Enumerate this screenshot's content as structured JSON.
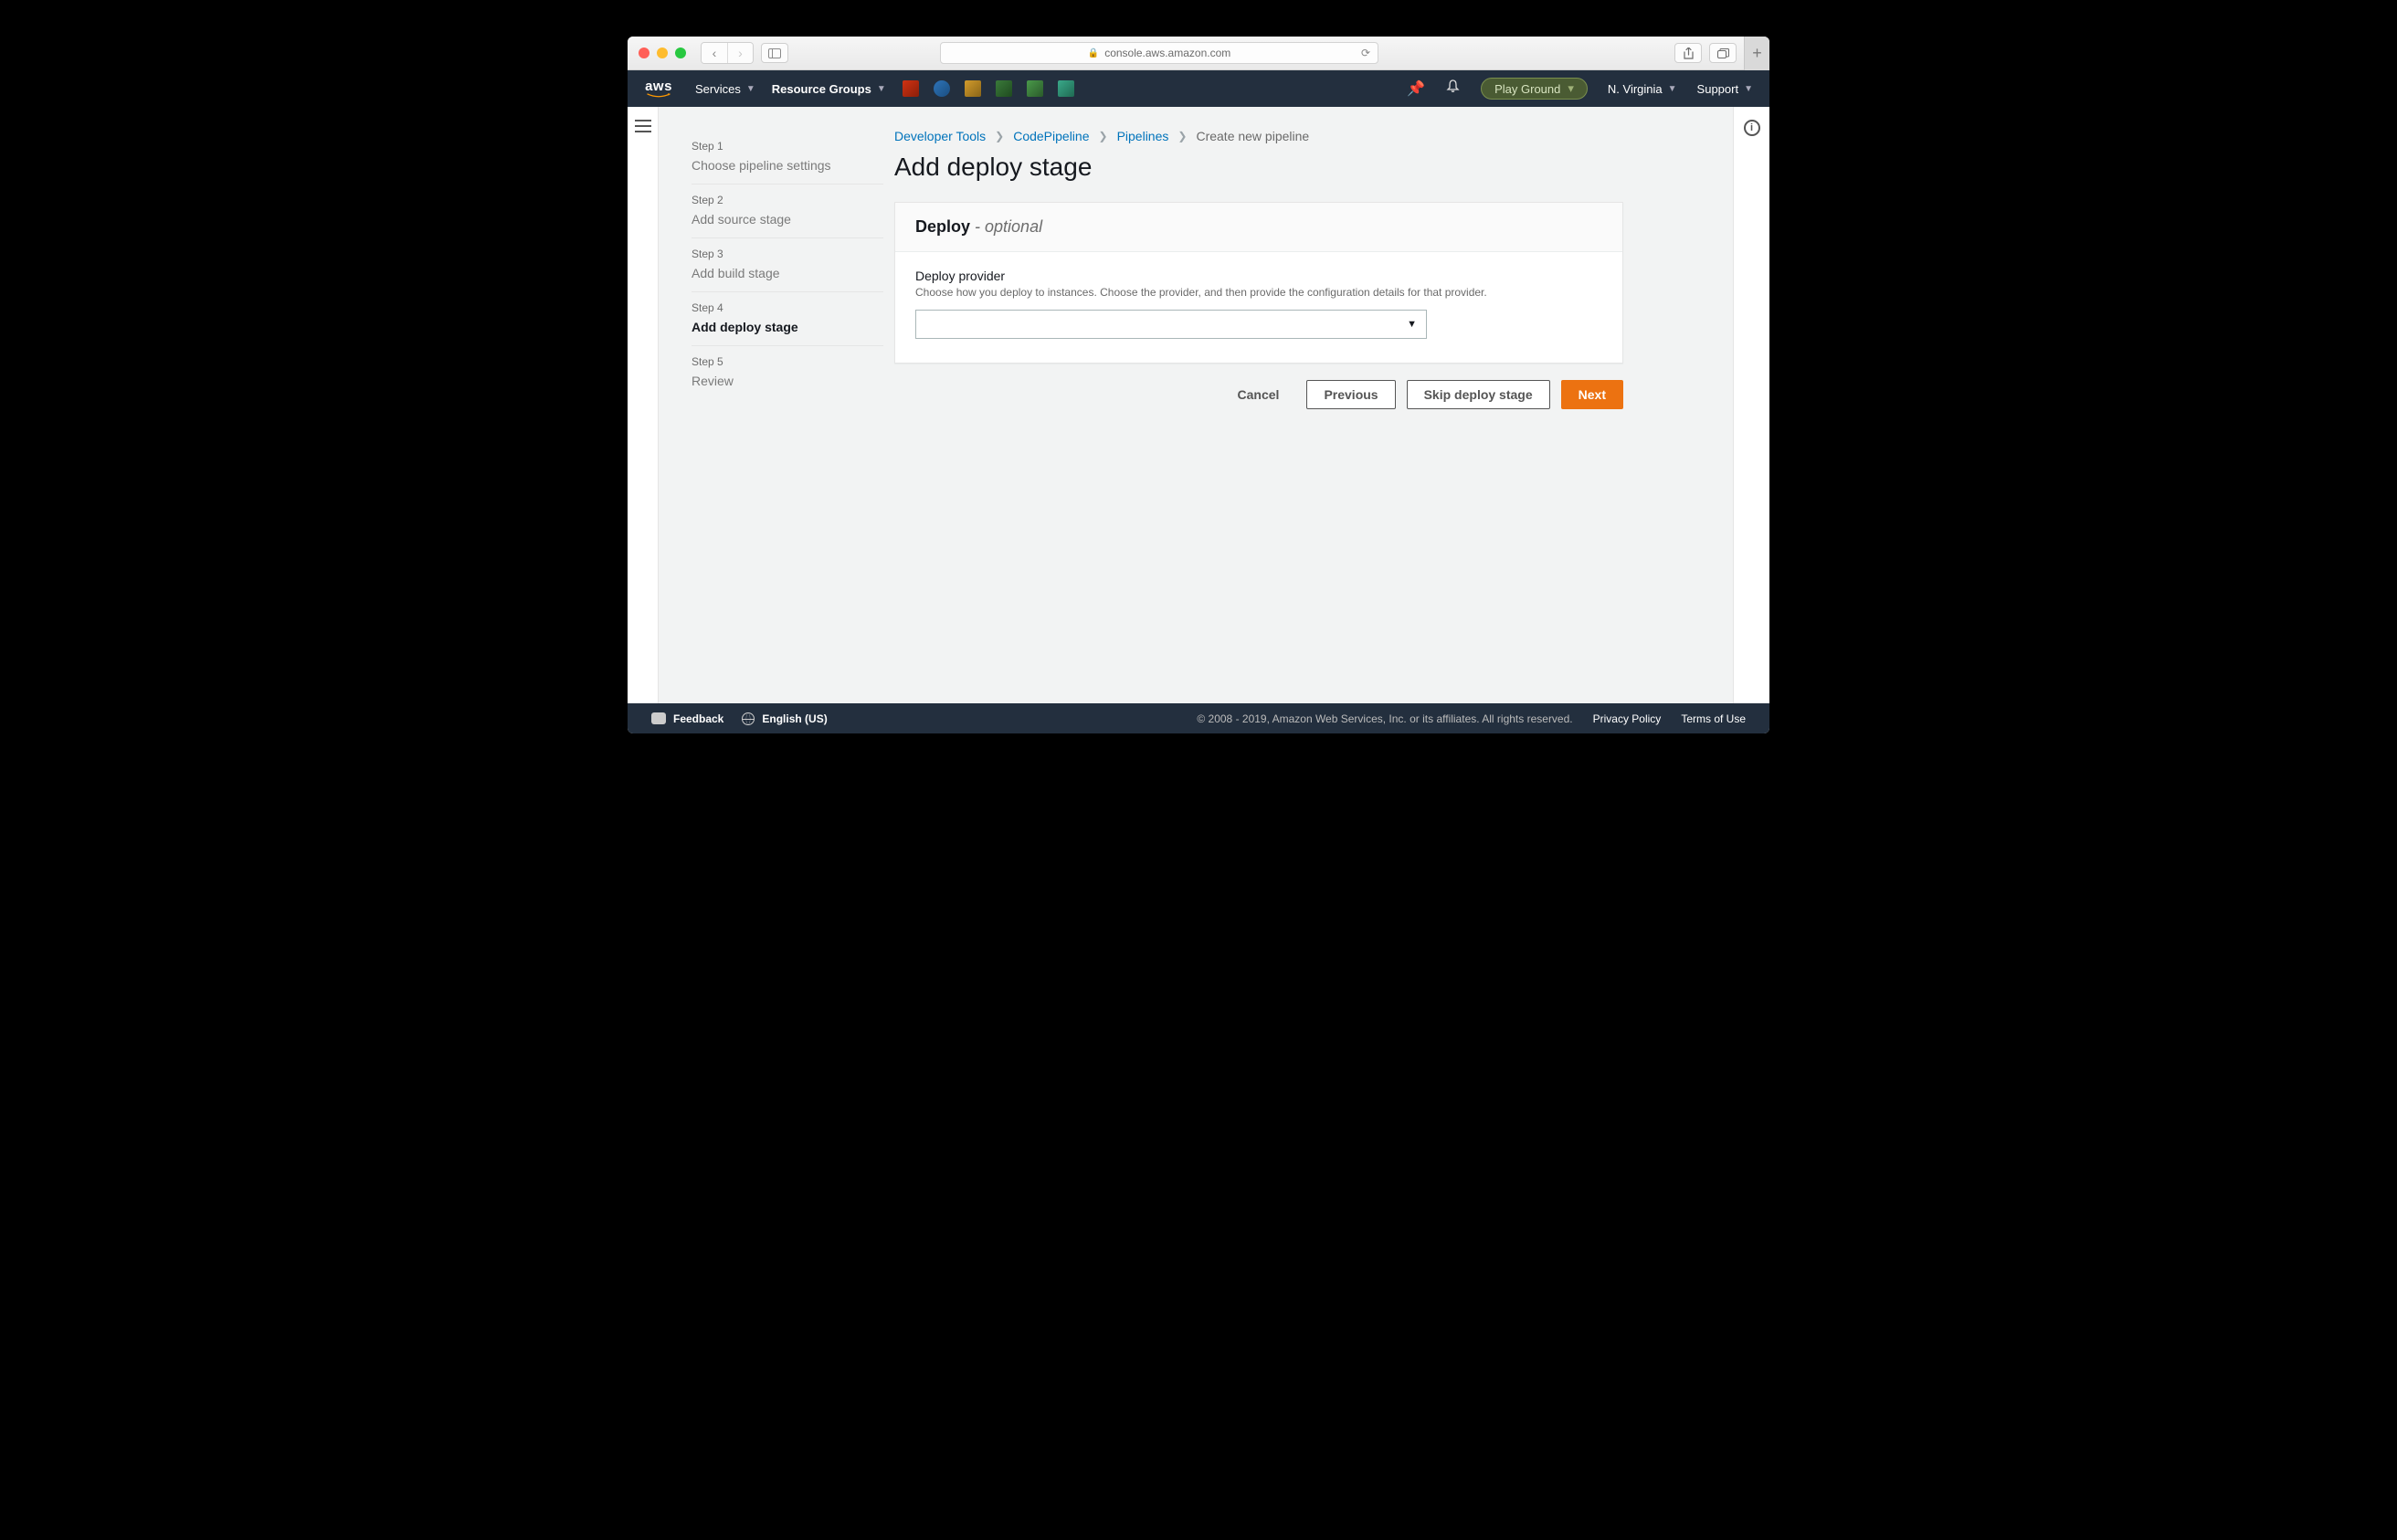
{
  "browser": {
    "url": "console.aws.amazon.com"
  },
  "awsbar": {
    "services": "Services",
    "resource_groups": "Resource Groups",
    "account": "Play Ground",
    "region": "N. Virginia",
    "support": "Support"
  },
  "steps": [
    {
      "num": "Step 1",
      "title": "Choose pipeline settings"
    },
    {
      "num": "Step 2",
      "title": "Add source stage"
    },
    {
      "num": "Step 3",
      "title": "Add build stage"
    },
    {
      "num": "Step 4",
      "title": "Add deploy stage"
    },
    {
      "num": "Step 5",
      "title": "Review"
    }
  ],
  "breadcrumb": {
    "a": "Developer Tools",
    "b": "CodePipeline",
    "c": "Pipelines",
    "d": "Create new pipeline"
  },
  "page": {
    "title": "Add deploy stage",
    "panel_title": "Deploy",
    "panel_optional": "- optional",
    "field_label": "Deploy provider",
    "field_help": "Choose how you deploy to instances. Choose the provider, and then provide the configuration details for that provider."
  },
  "actions": {
    "cancel": "Cancel",
    "previous": "Previous",
    "skip": "Skip deploy stage",
    "next": "Next"
  },
  "footer": {
    "feedback": "Feedback",
    "language": "English (US)",
    "copyright": "© 2008 - 2019, Amazon Web Services, Inc. or its affiliates. All rights reserved.",
    "privacy": "Privacy Policy",
    "terms": "Terms of Use"
  }
}
